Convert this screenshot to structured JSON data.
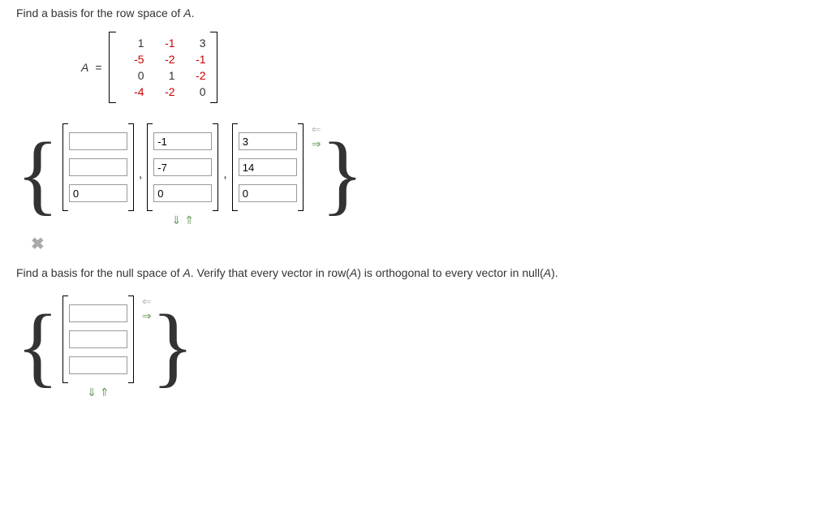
{
  "prompt1_prefix": "Find a basis for the row space of ",
  "prompt1_var": "A",
  "prompt1_suffix": ".",
  "matrix_label": "A",
  "equals": "=",
  "matrix": [
    [
      {
        "v": "1",
        "c": ""
      },
      {
        "v": "-1",
        "c": "red"
      },
      {
        "v": "3",
        "c": ""
      }
    ],
    [
      {
        "v": "-5",
        "c": "red"
      },
      {
        "v": "-2",
        "c": "red"
      },
      {
        "v": "-1",
        "c": "red"
      }
    ],
    [
      {
        "v": "0",
        "c": ""
      },
      {
        "v": "1",
        "c": ""
      },
      {
        "v": "-2",
        "c": "red"
      }
    ],
    [
      {
        "v": "-4",
        "c": "red"
      },
      {
        "v": "-2",
        "c": "red"
      },
      {
        "v": "0",
        "c": ""
      }
    ]
  ],
  "answer1": {
    "vectors": [
      [
        "",
        "",
        "0"
      ],
      [
        "-1",
        "-7",
        "0"
      ],
      [
        "3",
        "14",
        "0"
      ]
    ]
  },
  "prompt2_prefix": "Find a basis for the null space of ",
  "prompt2_var": "A",
  "prompt2_mid": ". Verify that every vector in row(",
  "prompt2_var2": "A",
  "prompt2_mid2": ") is orthogonal to every vector in null(",
  "prompt2_var3": "A",
  "prompt2_suffix": ").",
  "answer2": {
    "vectors": [
      [
        "",
        "",
        ""
      ]
    ]
  },
  "icons": {
    "wrong": "✖",
    "arrow_left": "⇐",
    "arrow_right": "⇒",
    "arrow_down": "⇓",
    "arrow_up": "⇑"
  }
}
